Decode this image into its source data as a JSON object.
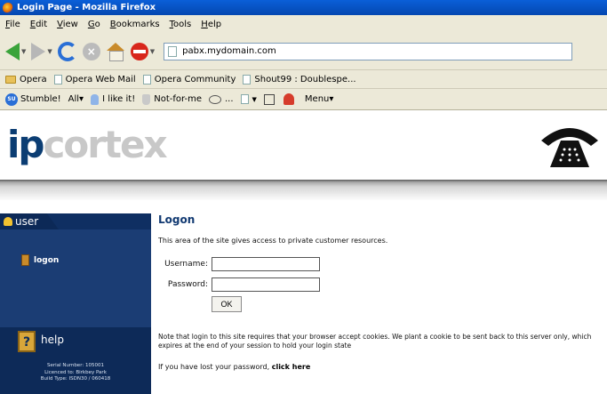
{
  "window": {
    "title": "Login Page - Mozilla Firefox"
  },
  "menu": [
    "File",
    "Edit",
    "View",
    "Go",
    "Bookmarks",
    "Tools",
    "Help"
  ],
  "address_bar": {
    "url": "pabx.mydomain.com"
  },
  "bookmarks": [
    "Opera",
    "Opera Web Mail",
    "Opera Community",
    "Shout99 : Doublespe..."
  ],
  "stumble_toolbar": {
    "su_badge": "SU",
    "stumble": "Stumble!",
    "all": "All▾",
    "like": "I like it!",
    "notforme": "Not-for-me",
    "dots": "...",
    "menu": "Menu▾"
  },
  "page": {
    "logo": {
      "ip": "ip",
      "cortex": "cortex"
    },
    "sidebar": {
      "user_tab": "user",
      "logon_link": "logon",
      "help_label": "help",
      "help_icon_char": "?",
      "info": [
        "Serial Number: 105001",
        "Licenced to: Birkbey Park",
        "Build Type: ISDN30 / 060418"
      ]
    },
    "main": {
      "title": "Logon",
      "intro": "This area of the site gives access to private customer resources.",
      "username_label": "Username:",
      "password_label": "Password:",
      "username_value": "",
      "password_value": "",
      "ok_label": "OK",
      "cookie_note": "Note that login to this site requires that your browser accept cookies. We plant a cookie to be sent back to this server only, which expires at the end of your session to hold your login state",
      "lost_pw_prefix": "If you have lost your password, ",
      "lost_pw_link": "click here"
    }
  },
  "colors": {
    "sidebar_bg": "#0f2f62",
    "title_blue": "#123a72",
    "titlebar_blue": "#0a5fd8"
  }
}
